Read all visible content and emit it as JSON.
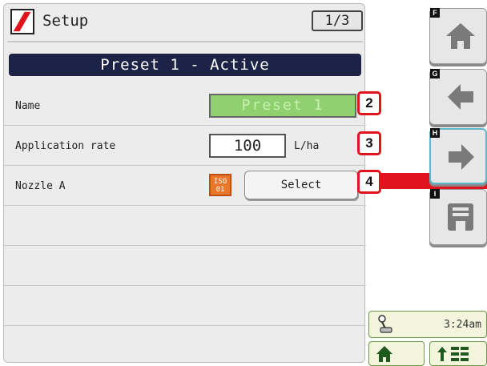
{
  "header": {
    "title": "Setup",
    "page_indicator": "1/3"
  },
  "banner": "Preset 1 - Active",
  "rows": [
    {
      "label": "Name",
      "value": "Preset 1"
    },
    {
      "label": "Application rate",
      "value": "100",
      "unit": "L/ha"
    },
    {
      "label": "Nozzle A",
      "badge_line1": "ISO",
      "badge_line2": "01",
      "button": "Select"
    }
  ],
  "callouts": [
    "2",
    "3",
    "4"
  ],
  "softkeys": [
    {
      "letter": "F",
      "icon": "home-icon"
    },
    {
      "letter": "G",
      "icon": "arrow-left-icon"
    },
    {
      "letter": "H",
      "icon": "arrow-right-icon"
    },
    {
      "letter": "I",
      "icon": "save-icon"
    }
  ],
  "status": {
    "time": "3:24am",
    "icon": "joystick-icon"
  },
  "bottom_buttons": [
    {
      "icon": "home-icon"
    },
    {
      "icon": "up-arrow-grid-icon"
    }
  ],
  "colors": {
    "banner": "#1c2346",
    "name_field": "#8fd16e",
    "callout_border": "#e1131c",
    "iso_badge": "#e8772c"
  }
}
